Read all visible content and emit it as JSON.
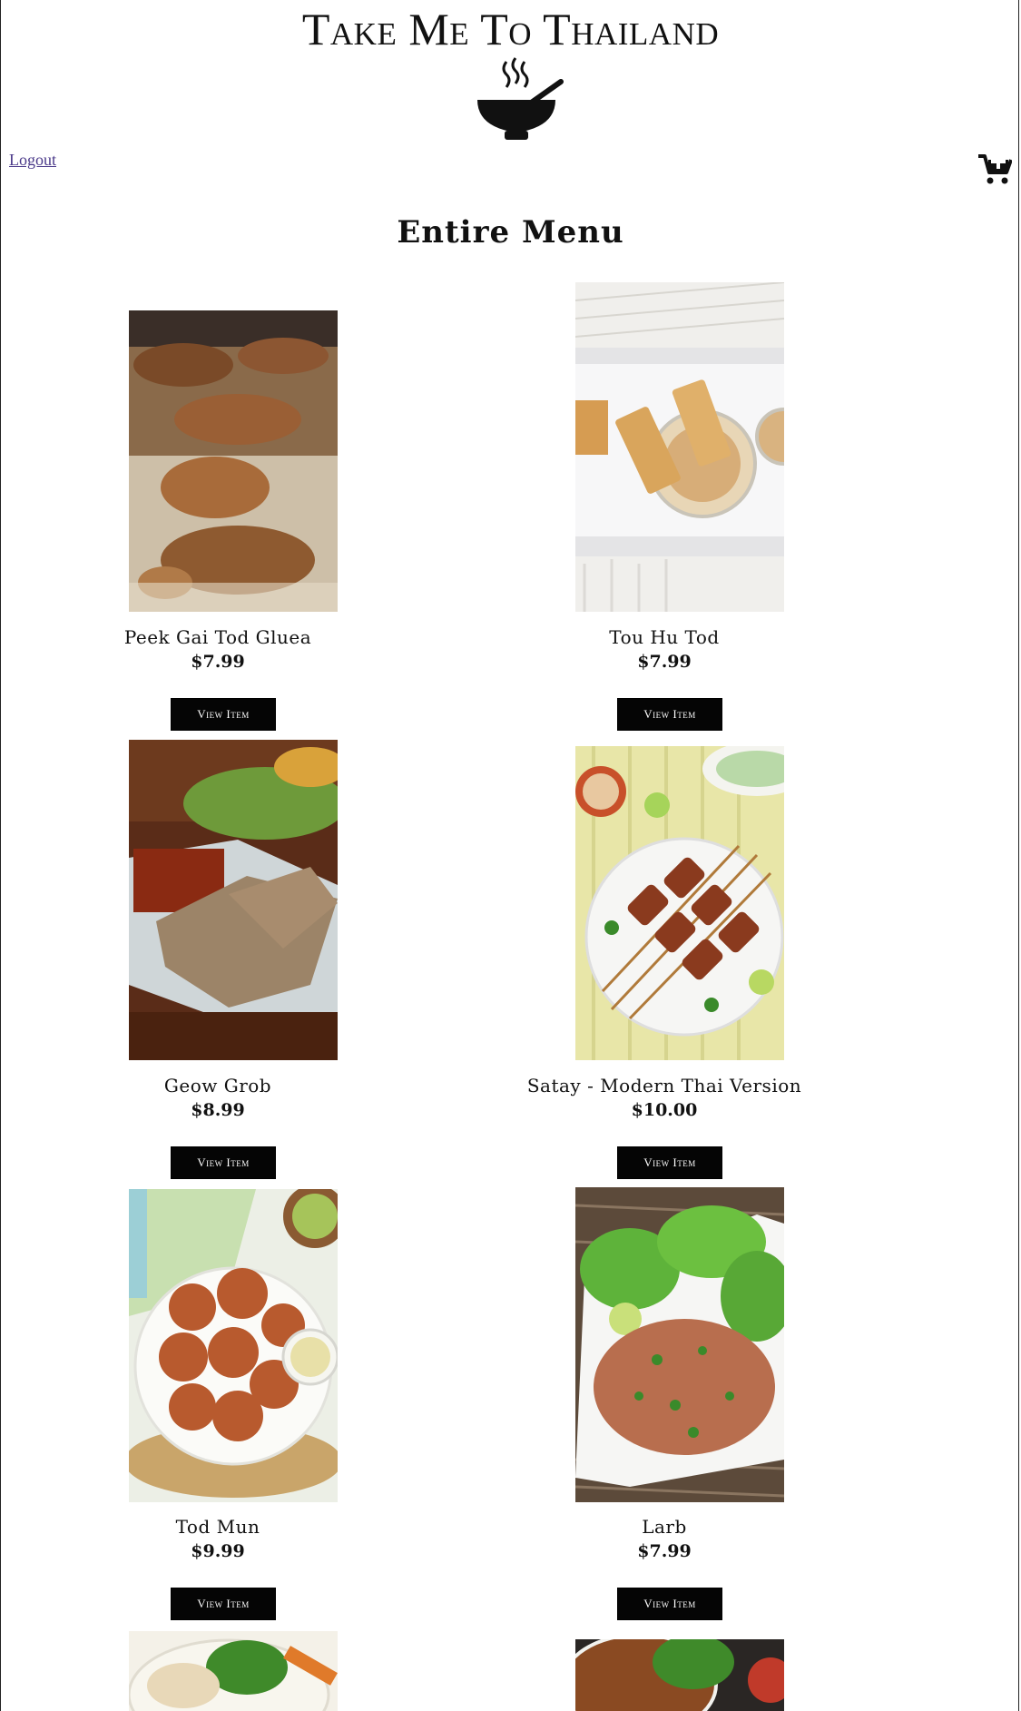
{
  "header": {
    "brand_title": "Take Me To Thailand",
    "logo_icon": "steaming-bowl-icon",
    "logout_label": "Logout",
    "cart_icon": "add-to-cart-icon"
  },
  "main": {
    "page_title": "Entire Menu",
    "view_item_label": "View Item",
    "items": [
      {
        "name": "Peek Gai Tod Gluea",
        "price": "$7.99"
      },
      {
        "name": "Tou Hu Tod",
        "price": "$7.99"
      },
      {
        "name": "Geow Grob",
        "price": "$8.99"
      },
      {
        "name": "Satay - Modern Thai Version",
        "price": "$10.00"
      },
      {
        "name": "Tod Mun",
        "price": "$9.99"
      },
      {
        "name": "Larb",
        "price": "$7.99"
      }
    ]
  },
  "colors": {
    "button_bg": "#050505",
    "button_text": "#ffffff",
    "link": "#4b3a8a"
  }
}
